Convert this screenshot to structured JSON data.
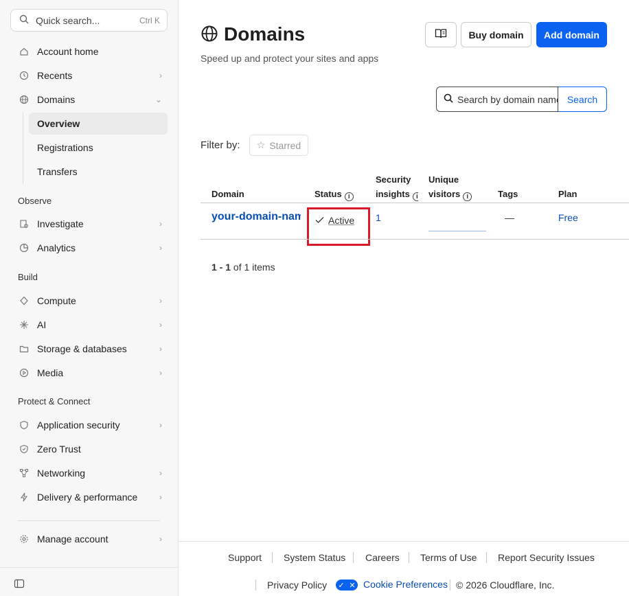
{
  "sidebar": {
    "search_placeholder": "Quick search...",
    "search_shortcut": "Ctrl K",
    "account_home": "Account home",
    "recents": "Recents",
    "domains": "Domains",
    "overview": "Overview",
    "registrations": "Registrations",
    "transfers": "Transfers",
    "observe_label": "Observe",
    "investigate": "Investigate",
    "analytics": "Analytics",
    "build_label": "Build",
    "compute": "Compute",
    "ai": "AI",
    "storage": "Storage & databases",
    "media": "Media",
    "protect_label": "Protect & Connect",
    "app_security": "Application security",
    "zero_trust": "Zero Trust",
    "networking": "Networking",
    "delivery": "Delivery & performance",
    "manage_account": "Manage account"
  },
  "header": {
    "title": "Domains",
    "subtitle": "Speed up and protect your sites and apps",
    "buy_domain": "Buy domain",
    "add_domain": "Add domain"
  },
  "domain_search": {
    "placeholder": "Search by domain name",
    "button": "Search"
  },
  "filter": {
    "label": "Filter by:",
    "starred": "Starred"
  },
  "table": {
    "col_domain": "Domain",
    "col_status": "Status",
    "col_security_1": "Security",
    "col_security_2": "insights",
    "col_visitors_1": "Unique",
    "col_visitors_2": "visitors",
    "col_tags": "Tags",
    "col_plan": "Plan",
    "row": {
      "domain": "your-domain-name",
      "status": "Active",
      "insights": "1",
      "tags": "—",
      "plan": "Free"
    }
  },
  "pagination": {
    "range": "1 - 1",
    "suffix": "of 1 items"
  },
  "footer": {
    "support": "Support",
    "system_status": "System Status",
    "careers": "Careers",
    "terms": "Terms of Use",
    "report": "Report Security Issues",
    "privacy": "Privacy Policy",
    "cookie": "Cookie Preferences",
    "copyright": "© 2026 Cloudflare, Inc."
  },
  "colors": {
    "primary": "#0a62f0",
    "link": "#0a4eb3",
    "highlight": "#d91a2a"
  }
}
